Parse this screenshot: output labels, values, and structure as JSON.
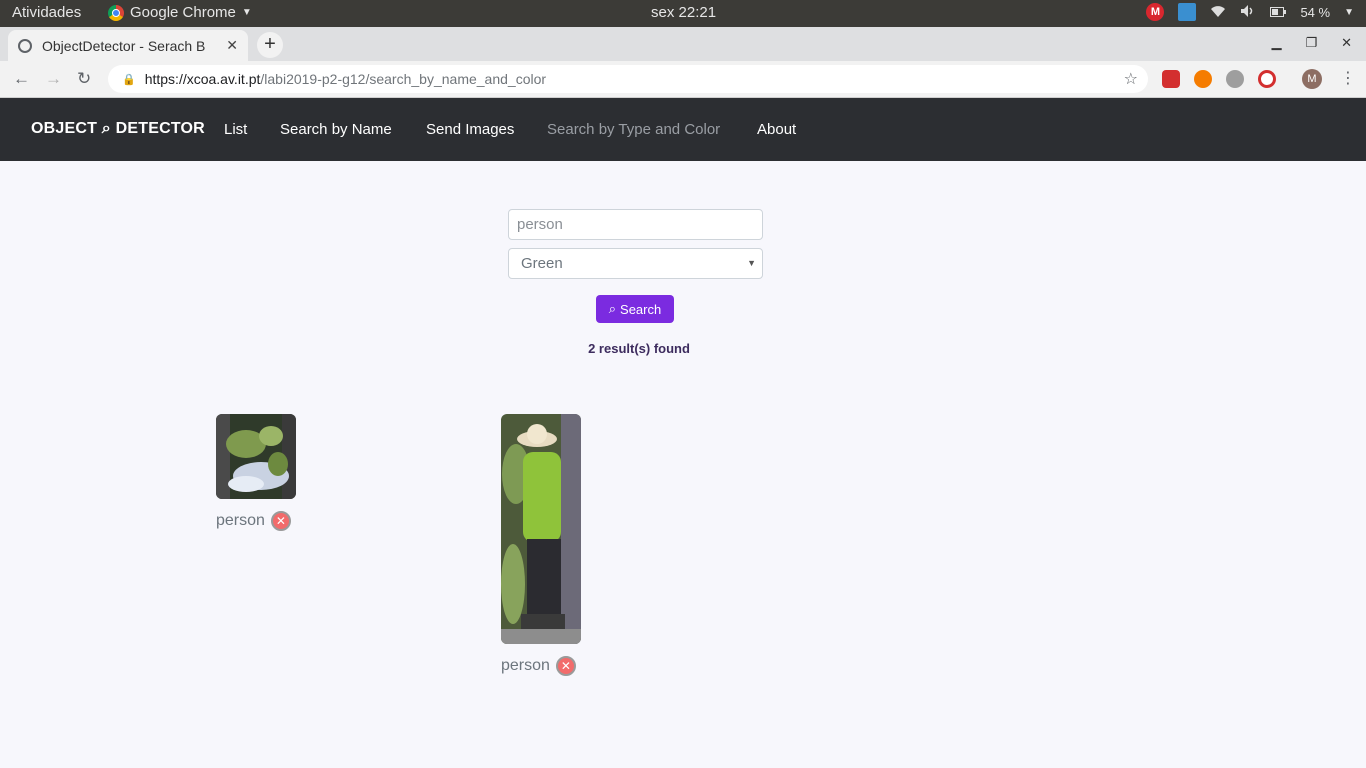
{
  "system": {
    "activities": "Atividades",
    "app_name": "Google Chrome",
    "clock": "sex 22:21",
    "battery": "54 %",
    "tray_m_label": "M"
  },
  "browser": {
    "tab_title": "ObjectDetector - Serach B",
    "url_host": "https://xcoa.av.it.pt",
    "url_path": "/labi2019-p2-g12/search_by_name_and_color",
    "profile_initial": "M"
  },
  "site_nav": {
    "brand_left": "OBJECT",
    "brand_right": "DETECTOR",
    "links": [
      "List",
      "Search by Name",
      "Send Images",
      "Search by Type and Color",
      "About"
    ]
  },
  "form": {
    "name_placeholder": "person",
    "color_value": "Green",
    "search_label": "Search"
  },
  "results": {
    "count_text": "2 result(s) found",
    "items": [
      {
        "label": "person"
      },
      {
        "label": "person"
      }
    ]
  },
  "colors": {
    "navbar_bg": "#2c2e32",
    "accent": "#7b2be0",
    "delete": "#f26b6b"
  }
}
